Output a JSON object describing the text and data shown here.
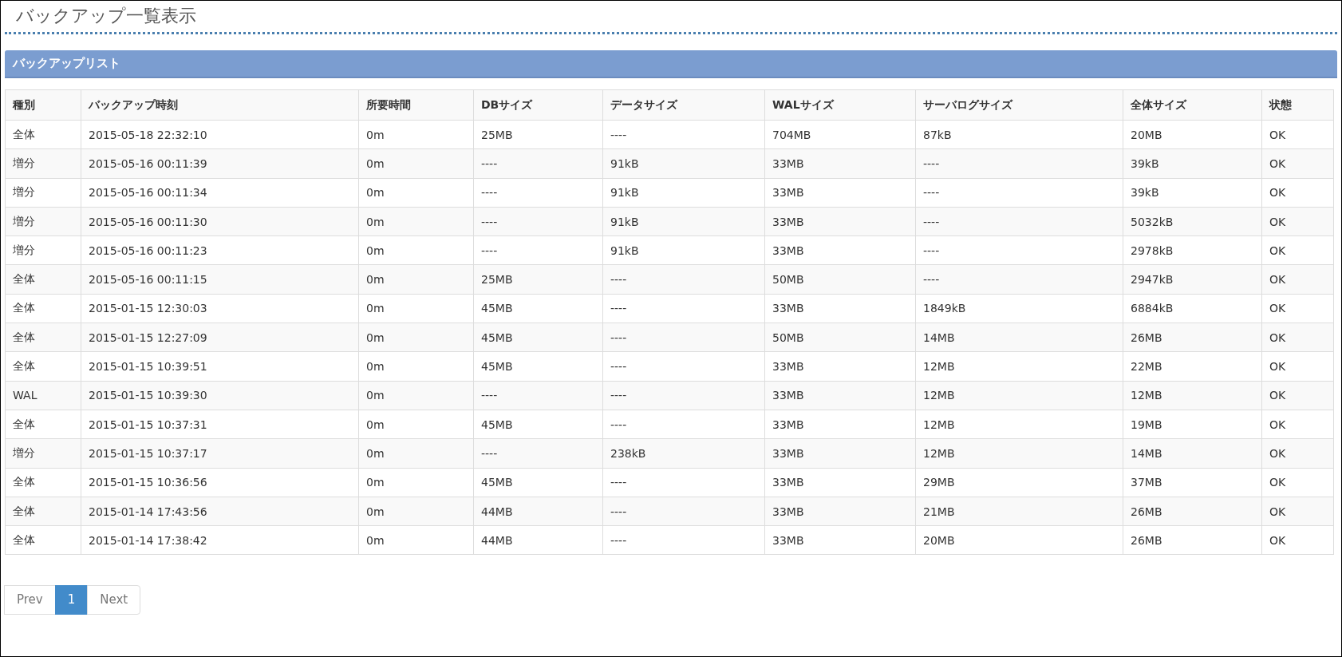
{
  "page_title": "バックアップ一覧表示",
  "panel": {
    "title": "バックアップリスト"
  },
  "table": {
    "columns": [
      "種別",
      "バックアップ時刻",
      "所要時間",
      "DBサイズ",
      "データサイズ",
      "WALサイズ",
      "サーバログサイズ",
      "全体サイズ",
      "状態"
    ],
    "rows": [
      [
        "全体",
        "2015-05-18 22:32:10",
        "0m",
        "25MB",
        "----",
        "704MB",
        "87kB",
        "20MB",
        "OK"
      ],
      [
        "増分",
        "2015-05-16 00:11:39",
        "0m",
        "----",
        "91kB",
        "33MB",
        "----",
        "39kB",
        "OK"
      ],
      [
        "増分",
        "2015-05-16 00:11:34",
        "0m",
        "----",
        "91kB",
        "33MB",
        "----",
        "39kB",
        "OK"
      ],
      [
        "増分",
        "2015-05-16 00:11:30",
        "0m",
        "----",
        "91kB",
        "33MB",
        "----",
        "5032kB",
        "OK"
      ],
      [
        "増分",
        "2015-05-16 00:11:23",
        "0m",
        "----",
        "91kB",
        "33MB",
        "----",
        "2978kB",
        "OK"
      ],
      [
        "全体",
        "2015-05-16 00:11:15",
        "0m",
        "25MB",
        "----",
        "50MB",
        "----",
        "2947kB",
        "OK"
      ],
      [
        "全体",
        "2015-01-15 12:30:03",
        "0m",
        "45MB",
        "----",
        "33MB",
        "1849kB",
        "6884kB",
        "OK"
      ],
      [
        "全体",
        "2015-01-15 12:27:09",
        "0m",
        "45MB",
        "----",
        "50MB",
        "14MB",
        "26MB",
        "OK"
      ],
      [
        "全体",
        "2015-01-15 10:39:51",
        "0m",
        "45MB",
        "----",
        "33MB",
        "12MB",
        "22MB",
        "OK"
      ],
      [
        "WAL",
        "2015-01-15 10:39:30",
        "0m",
        "----",
        "----",
        "33MB",
        "12MB",
        "12MB",
        "OK"
      ],
      [
        "全体",
        "2015-01-15 10:37:31",
        "0m",
        "45MB",
        "----",
        "33MB",
        "12MB",
        "19MB",
        "OK"
      ],
      [
        "増分",
        "2015-01-15 10:37:17",
        "0m",
        "----",
        "238kB",
        "33MB",
        "12MB",
        "14MB",
        "OK"
      ],
      [
        "全体",
        "2015-01-15 10:36:56",
        "0m",
        "45MB",
        "----",
        "33MB",
        "29MB",
        "37MB",
        "OK"
      ],
      [
        "全体",
        "2015-01-14 17:43:56",
        "0m",
        "44MB",
        "----",
        "33MB",
        "21MB",
        "26MB",
        "OK"
      ],
      [
        "全体",
        "2015-01-14 17:38:42",
        "0m",
        "44MB",
        "----",
        "33MB",
        "20MB",
        "26MB",
        "OK"
      ]
    ]
  },
  "pagination": [
    {
      "label": "Prev",
      "selected": false,
      "disabled": true
    },
    {
      "label": "1",
      "selected": true,
      "disabled": false
    },
    {
      "label": "Next",
      "selected": false,
      "disabled": true
    }
  ]
}
